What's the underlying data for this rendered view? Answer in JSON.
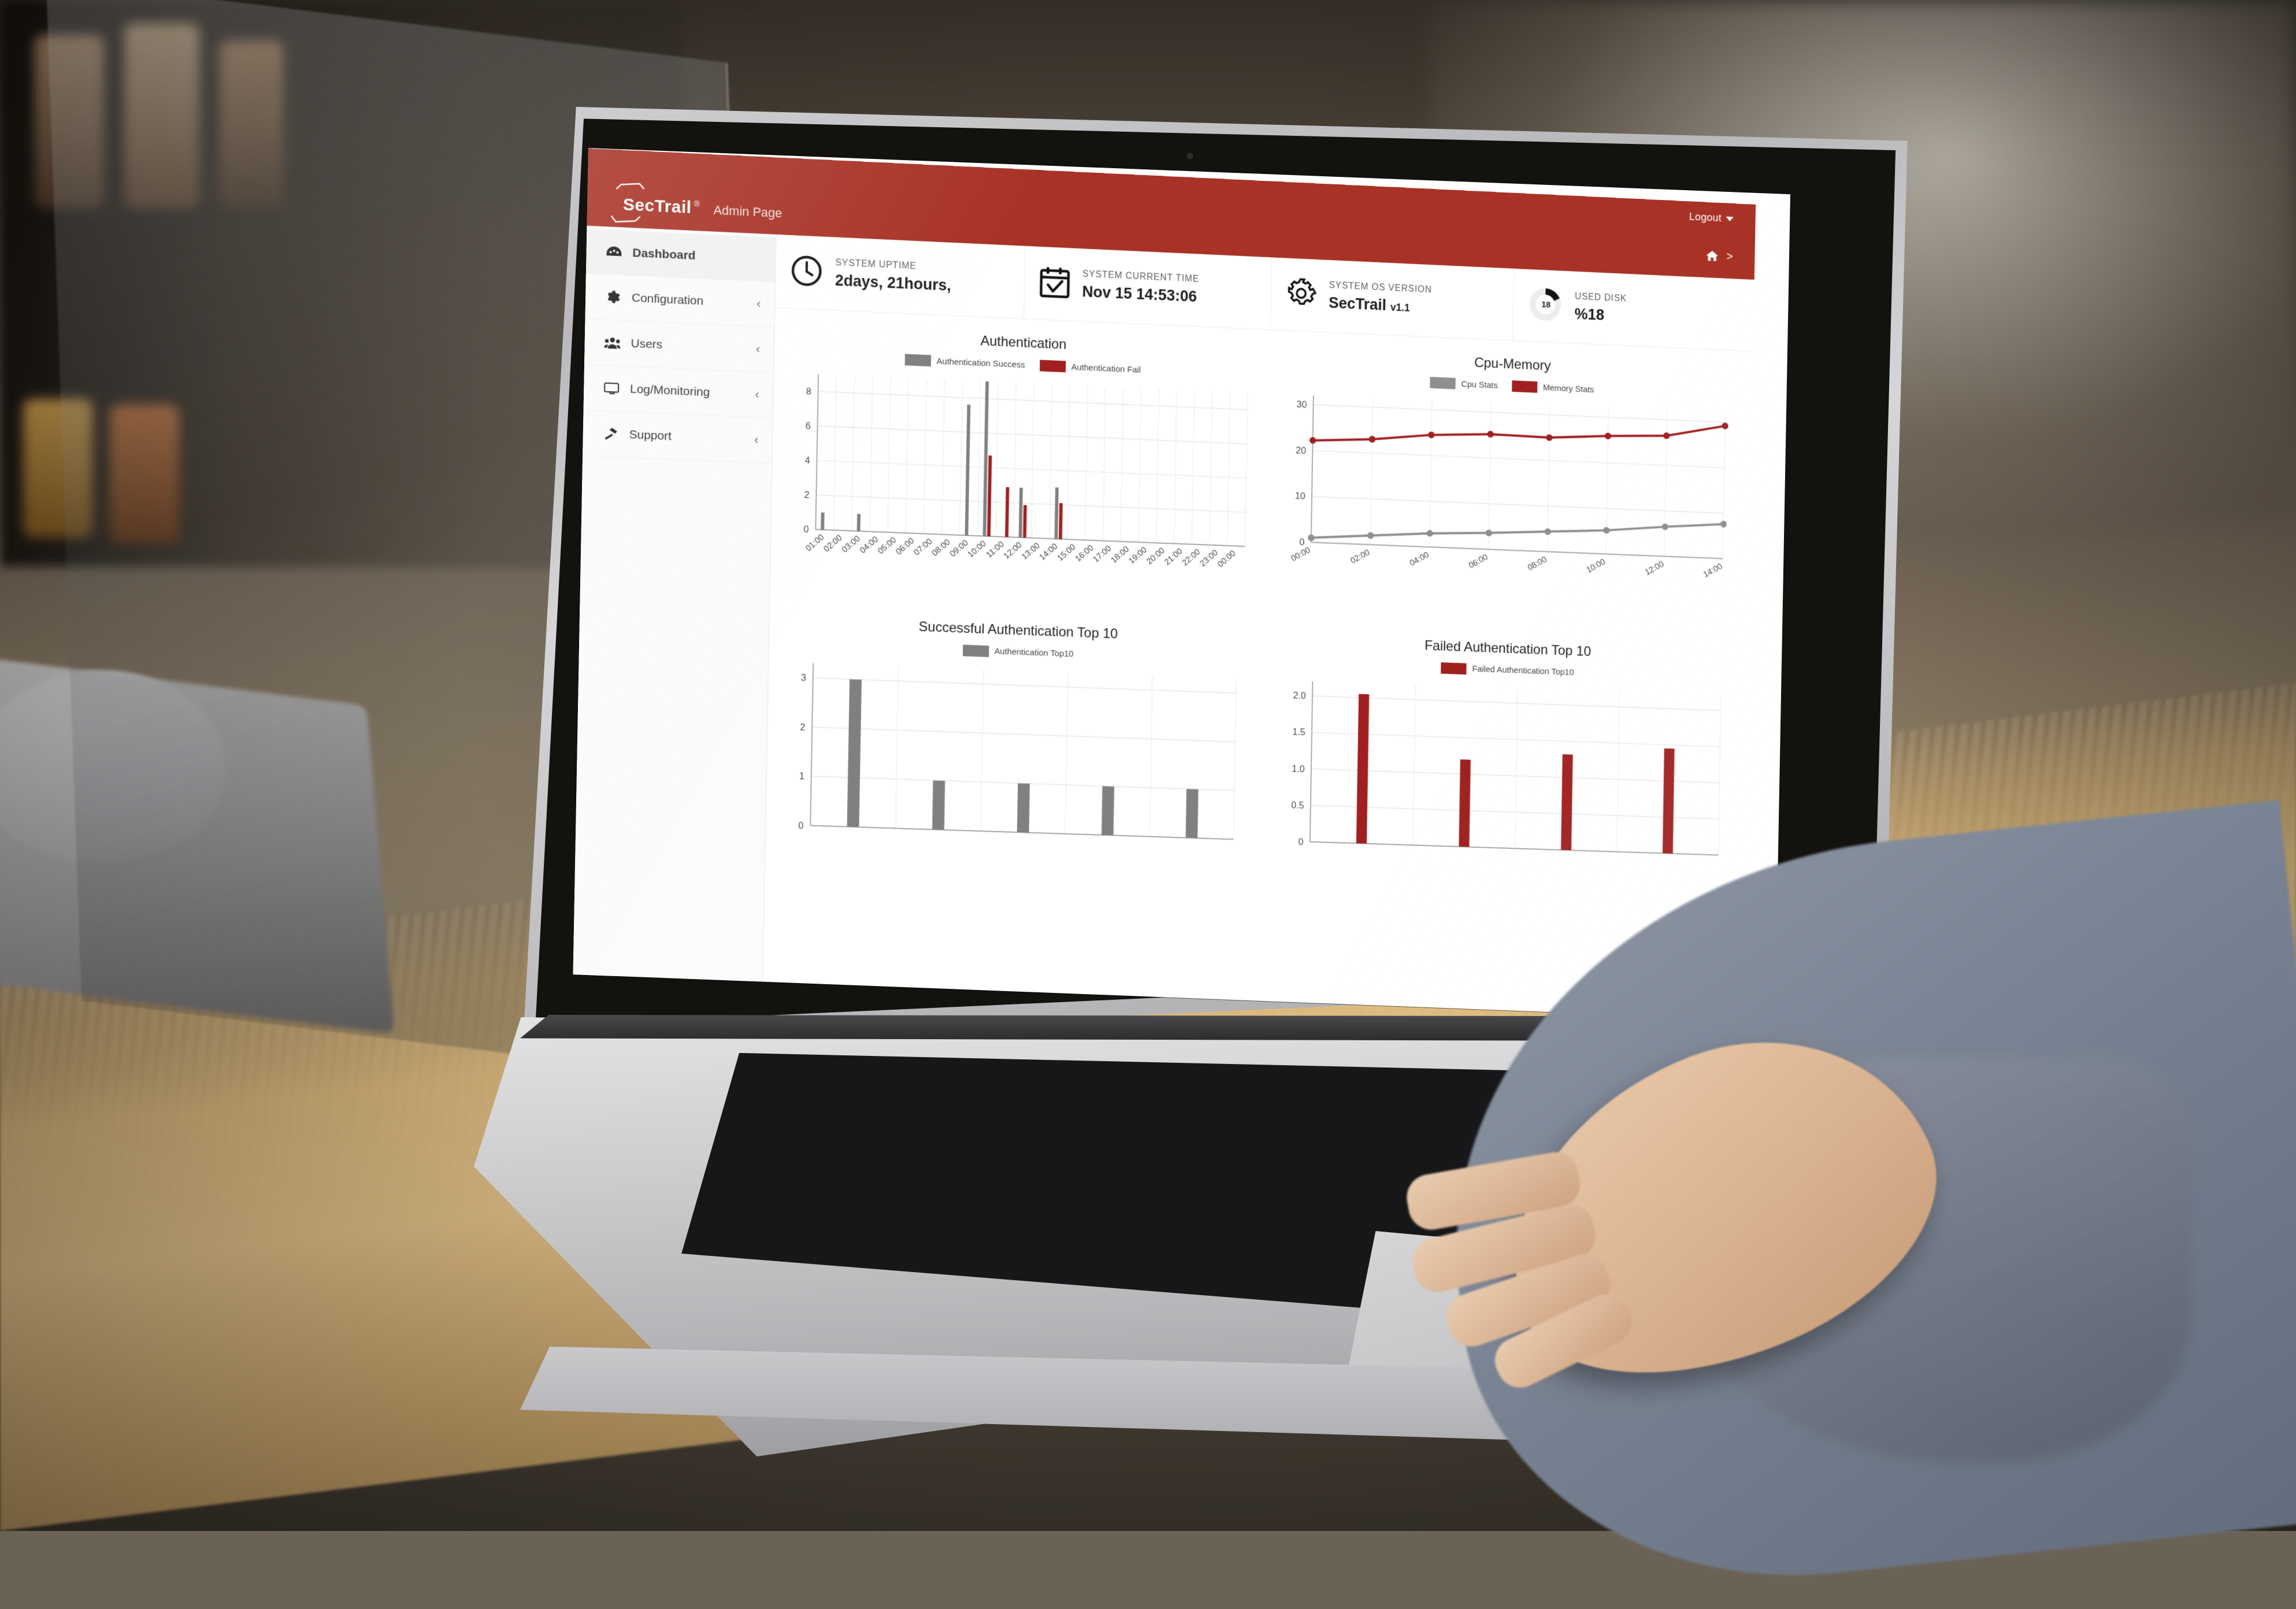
{
  "brand": {
    "name": "SecTrail",
    "trademark": "®",
    "subtitle": "Admin Page",
    "accent_color": "#a93226"
  },
  "topbar": {
    "logout_label": "Logout"
  },
  "breadcrumb": {
    "home_icon": "home-icon",
    "separator": ">"
  },
  "sidebar": {
    "items": [
      {
        "label": "Dashboard",
        "icon": "tachometer-icon",
        "active": true,
        "has_chevron": false
      },
      {
        "label": "Configuration",
        "icon": "gear-icon",
        "active": false,
        "has_chevron": true
      },
      {
        "label": "Users",
        "icon": "users-icon",
        "active": false,
        "has_chevron": true
      },
      {
        "label": "Log/Monitoring",
        "icon": "monitor-icon",
        "active": false,
        "has_chevron": true
      },
      {
        "label": "Support",
        "icon": "hammer-icon",
        "active": false,
        "has_chevron": true
      }
    ],
    "chevron_glyph": "‹"
  },
  "cards": [
    {
      "label": "SYSTEM UPTIME",
      "value": "2days, 21hours,",
      "icon": "clock-icon"
    },
    {
      "label": "SYSTEM CURRENT TIME",
      "value": "Nov 15 14:53:06",
      "icon": "calendar-check-icon"
    },
    {
      "label": "SYSTEM OS VERSION",
      "value": "SecTrail",
      "value_suffix": "v1.1",
      "icon": "gear-icon"
    },
    {
      "label": "USED DISK",
      "value": "%18",
      "icon": "donut-chart",
      "donut_value": "18",
      "donut_percent": 18
    }
  ],
  "chart_data": [
    {
      "id": "authentication",
      "type": "bar",
      "title": "Authentication",
      "legend": [
        {
          "name": "Authentication Success",
          "color": "#808080"
        },
        {
          "name": "Authentication Fail",
          "color": "#a02020"
        }
      ],
      "legend_position": "top",
      "grid": true,
      "xlabel": "",
      "ylabel": "",
      "ylim": [
        0,
        9
      ],
      "yticks": [
        0,
        2,
        4,
        6,
        8
      ],
      "categories": [
        "01:00",
        "02:00",
        "03:00",
        "04:00",
        "05:00",
        "06:00",
        "07:00",
        "08:00",
        "09:00",
        "10:00",
        "11:00",
        "12:00",
        "13:00",
        "14:00",
        "15:00",
        "16:00",
        "17:00",
        "18:00",
        "19:00",
        "20:00",
        "21:00",
        "22:00",
        "23:00",
        "00:00"
      ],
      "series": [
        {
          "name": "Authentication Success",
          "color": "#808080",
          "values": [
            1,
            0,
            1,
            0,
            0,
            0,
            0,
            0,
            7.6,
            9,
            0,
            2.9,
            0,
            3,
            0,
            0,
            0,
            0,
            0,
            0,
            0,
            0,
            0,
            0
          ]
        },
        {
          "name": "Authentication Fail",
          "color": "#a02020",
          "values": [
            0,
            0,
            0,
            0,
            0,
            0,
            0,
            0,
            0,
            4.7,
            2.9,
            1.9,
            0,
            2.1,
            0,
            0,
            0,
            0,
            0,
            0,
            0,
            0,
            0,
            0
          ]
        }
      ]
    },
    {
      "id": "cpu-memory",
      "type": "line",
      "title": "Cpu-Memory",
      "legend": [
        {
          "name": "Cpu Stats",
          "color": "#8f8f8f"
        },
        {
          "name": "Memory Stats",
          "color": "#a02020"
        }
      ],
      "legend_position": "top",
      "grid": true,
      "xlabel": "",
      "ylabel": "",
      "ylim": [
        0,
        32
      ],
      "yticks": [
        0,
        10,
        20,
        30
      ],
      "x": [
        "00:00",
        "02:00",
        "04:00",
        "06:00",
        "08:00",
        "10:00",
        "12:00",
        "14:00"
      ],
      "series": [
        {
          "name": "Memory Stats",
          "color": "#a02020",
          "values": [
            22.2,
            23.0,
            24.5,
            25.2,
            25.0,
            25.9,
            26.5,
            29.2
          ]
        },
        {
          "name": "Cpu Stats",
          "color": "#8f8f8f",
          "values": [
            1.0,
            2.0,
            3.0,
            3.6,
            4.4,
            5.2,
            6.5,
            7.6
          ]
        }
      ]
    },
    {
      "id": "successful-authentication-top-10",
      "type": "bar",
      "title": "Successful Authentication Top 10",
      "legend": [
        {
          "name": "Authentication Top10",
          "color": "#808080"
        }
      ],
      "legend_position": "top",
      "grid": true,
      "xlabel": "",
      "ylabel": "",
      "ylim": [
        0,
        3.3
      ],
      "yticks": [
        0,
        1,
        2,
        3
      ],
      "categories": [
        "",
        "",
        "",
        "",
        ""
      ],
      "values": [
        3,
        1,
        1,
        1,
        1
      ]
    },
    {
      "id": "failed-authentication-top-10",
      "type": "bar",
      "title": "Failed Authentication Top 10",
      "legend": [
        {
          "name": "Failed Authentication Top10",
          "color": "#a02020"
        }
      ],
      "legend_position": "top",
      "grid": true,
      "xlabel": "",
      "ylabel": "",
      "ylim": [
        0,
        2.2
      ],
      "yticks": [
        0,
        0.5,
        1.0,
        1.5,
        2.0
      ],
      "ytick_labels": [
        "0",
        "0.5",
        "1.0",
        "1.5",
        "2.0"
      ],
      "categories": [
        "",
        "",
        "",
        ""
      ],
      "values": [
        2.05,
        1.2,
        1.32,
        1.45
      ]
    }
  ]
}
